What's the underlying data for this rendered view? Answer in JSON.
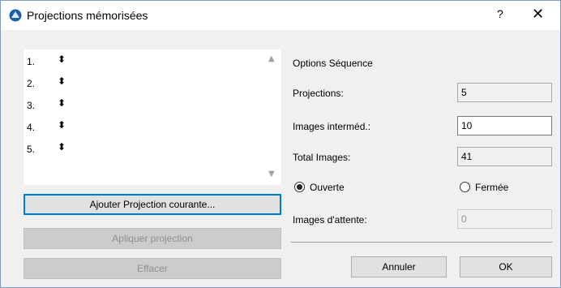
{
  "window": {
    "title": "Projections mémorisées",
    "help_label": "?",
    "close_label": "✕"
  },
  "list": {
    "items": [
      {
        "number": "1.",
        "sort_glyph": "⬍"
      },
      {
        "number": "2.",
        "sort_glyph": "⬍"
      },
      {
        "number": "3.",
        "sort_glyph": "⬍"
      },
      {
        "number": "4.",
        "sort_glyph": "⬍"
      },
      {
        "number": "5.",
        "sort_glyph": "⬍"
      }
    ],
    "scroll_up": "▲",
    "scroll_down": "▼"
  },
  "buttons": {
    "add_current": "Ajouter Projection courante...",
    "apply": "Apliquer projection",
    "delete": "Effacer",
    "cancel": "Annuler",
    "ok": "OK"
  },
  "options": {
    "heading": "Options Séquence",
    "projections_label": "Projections:",
    "projections_value": "5",
    "intermediate_label": "Images interméd.:",
    "intermediate_value": "10",
    "total_label": "Total Images:",
    "total_value": "41",
    "radio_open": "Ouverte",
    "radio_closed": "Fermée",
    "wait_label": "Images d'attente:",
    "wait_value": "0"
  },
  "colors": {
    "accent": "#0078d7",
    "icon_blue": "#1c5fa8"
  },
  "icons": {
    "app": "archicad-logo-icon",
    "close": "close-icon",
    "help": "help-icon"
  }
}
